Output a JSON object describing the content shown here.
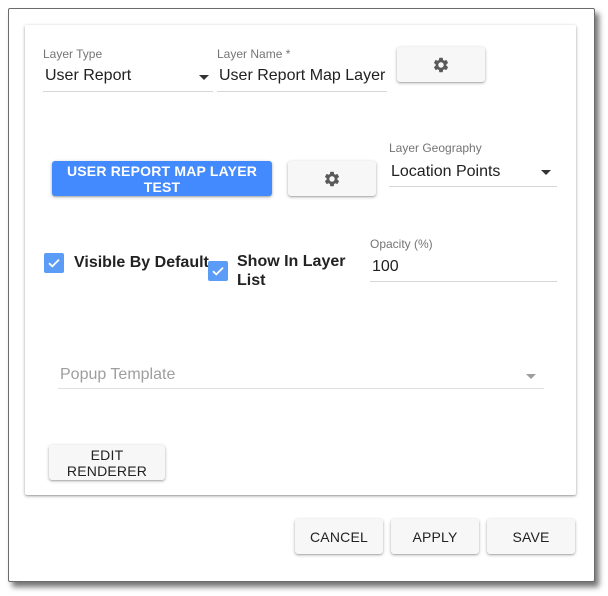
{
  "form": {
    "layer_type": {
      "label": "Layer Type",
      "value": "User Report"
    },
    "layer_name": {
      "label": "Layer Name *",
      "value": "User Report Map Layer"
    },
    "layer_name_settings_icon": "gear-icon",
    "test_button_label": "USER REPORT MAP LAYER TEST",
    "test_settings_icon": "gear-icon",
    "layer_geography": {
      "label": "Layer Geography",
      "value": "Location Points"
    },
    "visible_by_default": {
      "label": "Visible By Default",
      "checked": true
    },
    "show_in_layer_list": {
      "label": "Show In Layer List",
      "checked": true
    },
    "opacity": {
      "label": "Opacity (%)",
      "value": "100"
    },
    "popup_template": {
      "placeholder": "Popup Template",
      "value": ""
    },
    "edit_renderer_label": "EDIT RENDERER"
  },
  "footer": {
    "cancel_label": "CANCEL",
    "apply_label": "APPLY",
    "save_label": "SAVE"
  },
  "colors": {
    "primary": "#448aff",
    "checkbox": "#5b9cf6"
  }
}
